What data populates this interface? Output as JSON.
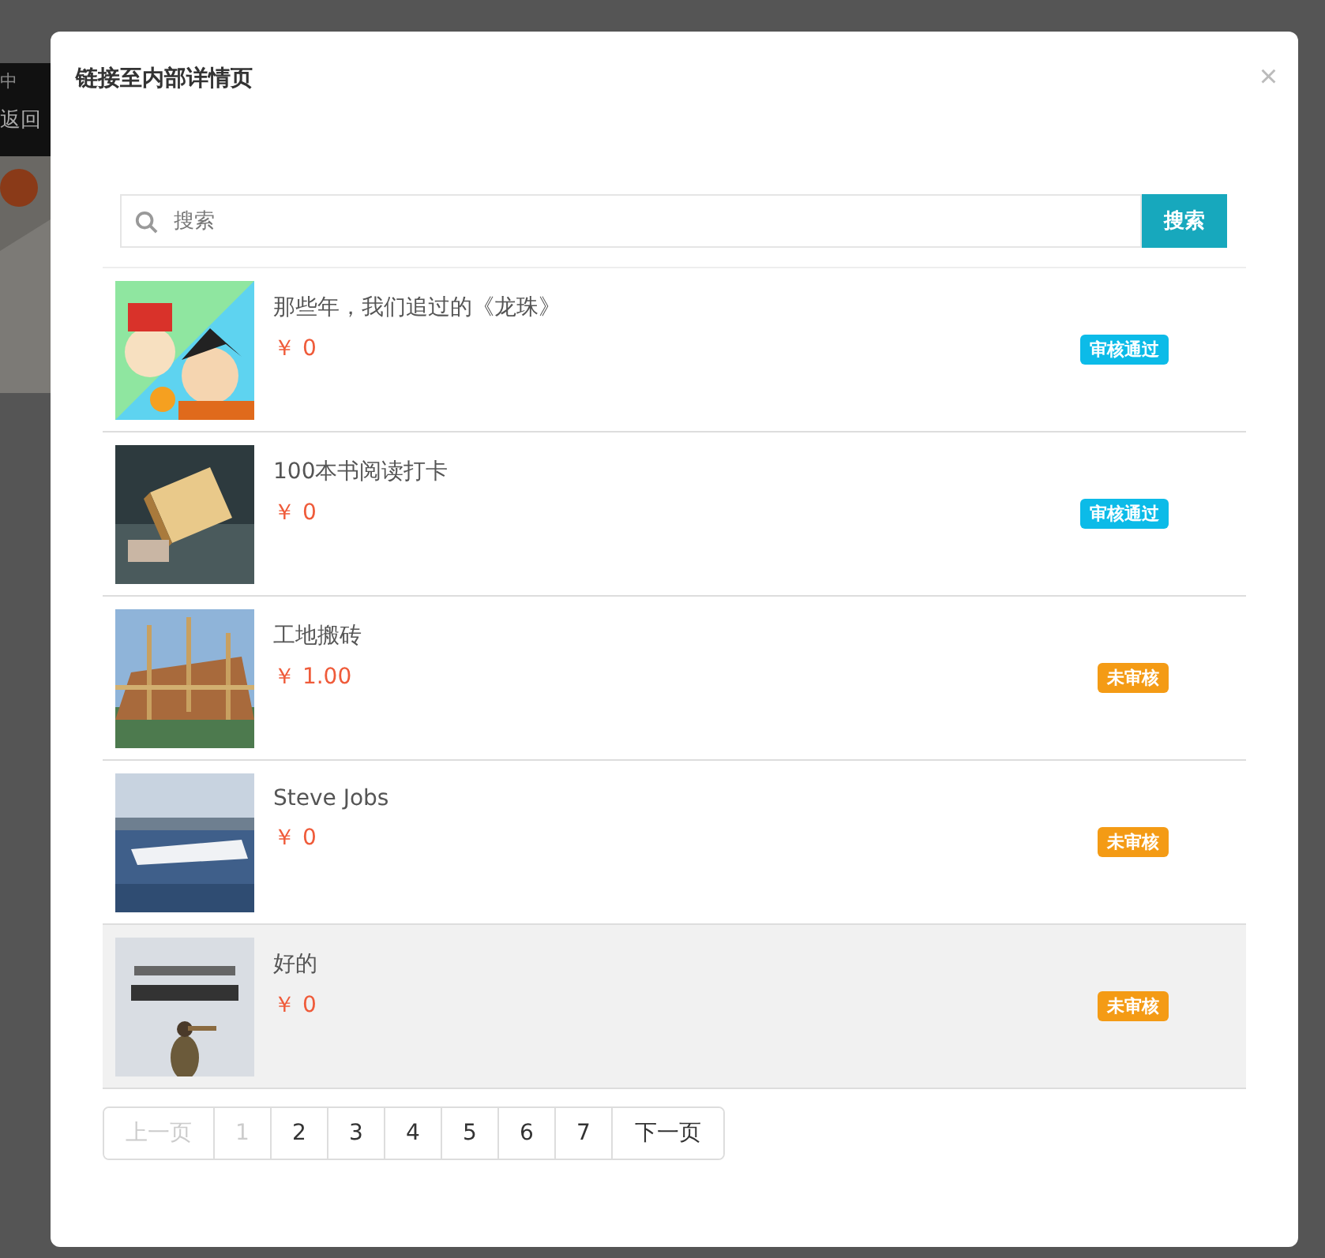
{
  "backdrop": {
    "status_text": "中",
    "back_label": "返回"
  },
  "dialog": {
    "title": "链接至内部详情页",
    "close": "×"
  },
  "search": {
    "placeholder": "搜索",
    "button": "搜索"
  },
  "items": [
    {
      "title": "那些年，我们追过的《龙珠》",
      "price": "￥ 0",
      "status": "审核通过",
      "color": "#0cbbe8",
      "selected": false
    },
    {
      "title": "100本书阅读打卡",
      "price": "￥ 0",
      "status": "审核通过",
      "color": "#0cbbe8",
      "selected": false
    },
    {
      "title": "工地搬砖",
      "price": "￥ 1.00",
      "status": "未审核",
      "color": "#f49b15",
      "selected": false
    },
    {
      "title": "Steve Jobs",
      "price": "￥ 0",
      "status": "未审核",
      "color": "#f49b15",
      "selected": false
    },
    {
      "title": "好的",
      "price": "￥ 0",
      "status": "未审核",
      "color": "#f49b15",
      "selected": true
    }
  ],
  "pagination": {
    "prev": {
      "label": "上一页",
      "disabled": true
    },
    "next": {
      "label": "下一页",
      "disabled": false
    },
    "pages": [
      {
        "label": "1",
        "selected": true
      },
      {
        "label": "2",
        "selected": false
      },
      {
        "label": "3",
        "selected": false
      },
      {
        "label": "4",
        "selected": false
      },
      {
        "label": "5",
        "selected": false
      },
      {
        "label": "6",
        "selected": false
      },
      {
        "label": "7",
        "selected": false
      }
    ]
  }
}
